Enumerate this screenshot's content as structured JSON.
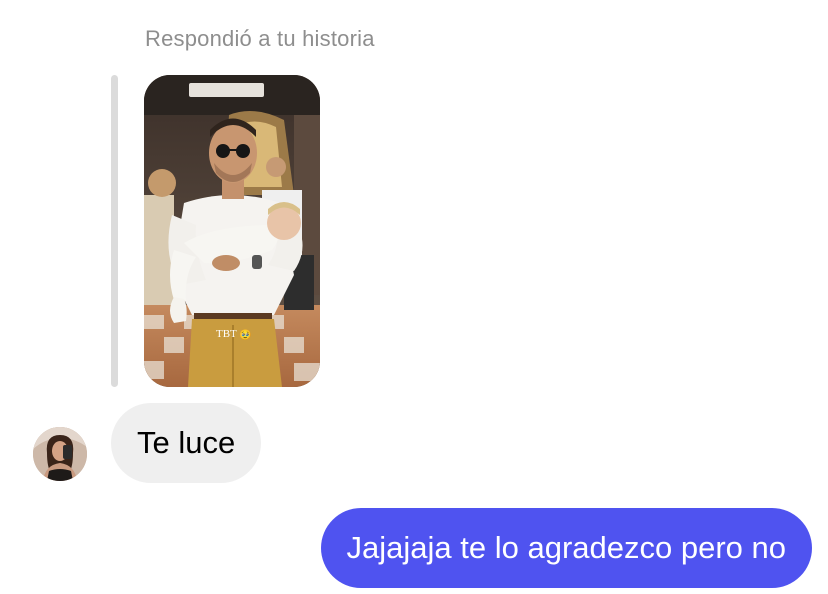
{
  "thread": {
    "reply_label": "Respondió a tu historia",
    "story": {
      "overlay_text": "TBT",
      "overlay_emoji": "🥹"
    },
    "messages": [
      {
        "direction": "incoming",
        "text": "Te luce"
      },
      {
        "direction": "outgoing",
        "text": "Jajajaja te lo agradezco pero no"
      }
    ]
  },
  "colors": {
    "outgoing_bubble": "#4f53f0",
    "incoming_bubble": "#efefef",
    "label": "#8e8e8e",
    "quote_bar": "#dbdbdb"
  },
  "icons": {
    "avatar": "profile-photo"
  }
}
